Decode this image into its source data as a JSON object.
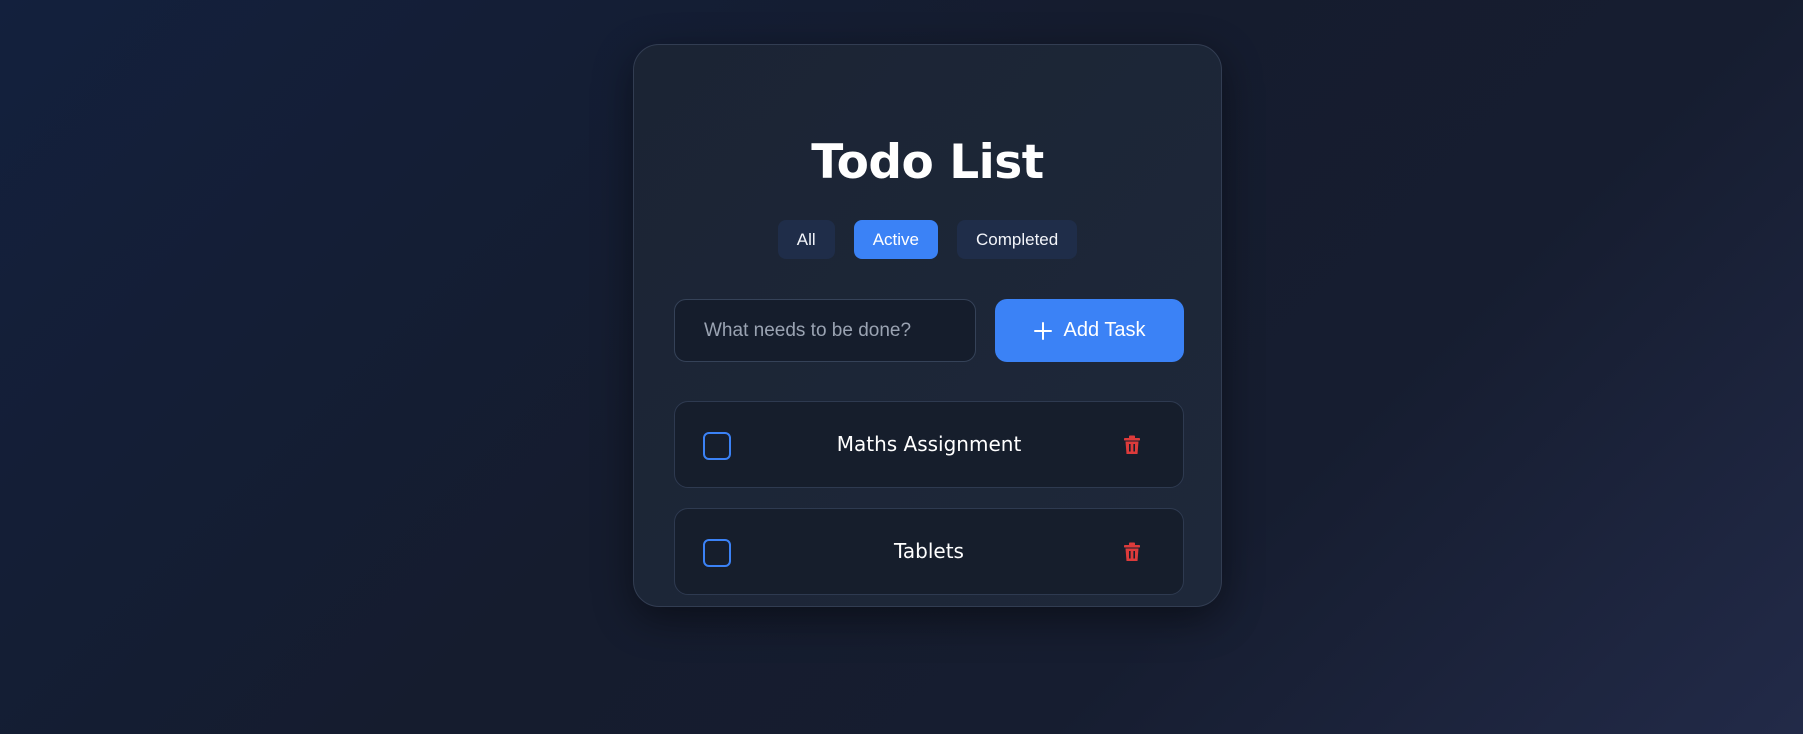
{
  "app": {
    "title": "Todo List"
  },
  "filters": [
    {
      "label": "All",
      "active": false
    },
    {
      "label": "Active",
      "active": true
    },
    {
      "label": "Completed",
      "active": false
    }
  ],
  "new_task": {
    "placeholder": "What needs to be done?",
    "value": "",
    "add_label": "Add Task",
    "add_icon": "plus-icon"
  },
  "tasks": [
    {
      "label": "Maths Assignment",
      "completed": false,
      "delete_icon": "trash-icon"
    },
    {
      "label": "Tablets",
      "completed": false,
      "delete_icon": "trash-icon"
    }
  ],
  "colors": {
    "accent": "#3b82f6",
    "danger": "#dc3b3b",
    "card_bg": "#1e283a",
    "page_bg": "#151c2e"
  }
}
